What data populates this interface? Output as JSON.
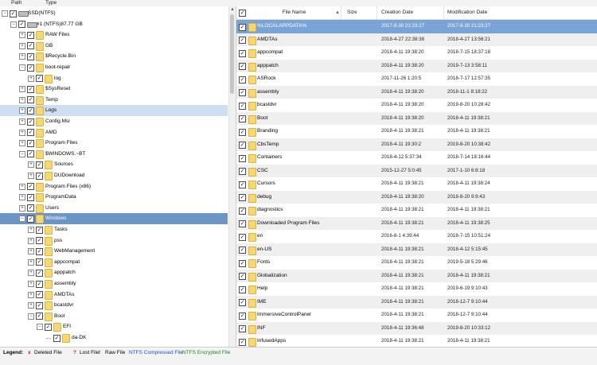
{
  "tabs": [
    "Path",
    "Type"
  ],
  "tree": [
    {
      "label": "SSD(NTFS)",
      "level": 0,
      "icon": "drive",
      "expander": "minus"
    },
    {
      "label": "#1 (NTFS)87.77 GB",
      "level": 1,
      "icon": "drive",
      "expander": "minus"
    },
    {
      "label": "RAW Files",
      "level": 2,
      "icon": "folder",
      "expander": "plus"
    },
    {
      "label": "GB",
      "level": 2,
      "icon": "folder",
      "expander": "plus"
    },
    {
      "label": "$Recycle.Bin",
      "level": 2,
      "icon": "folder",
      "expander": "plus"
    },
    {
      "label": "boot-repair",
      "level": 2,
      "icon": "folder",
      "expander": "minus"
    },
    {
      "label": "log",
      "level": 3,
      "icon": "folder",
      "expander": "plus"
    },
    {
      "label": "$SysReset",
      "level": 2,
      "icon": "folder",
      "expander": "plus"
    },
    {
      "label": "Temp",
      "level": 2,
      "icon": "folder",
      "expander": "plus"
    },
    {
      "label": "Logs",
      "level": 2,
      "icon": "folder",
      "expander": "plus",
      "selected": "light"
    },
    {
      "label": "Config.Msi",
      "level": 2,
      "icon": "folder",
      "expander": "plus"
    },
    {
      "label": "AMD",
      "level": 2,
      "icon": "folder",
      "expander": "plus"
    },
    {
      "label": "Program Files",
      "level": 2,
      "icon": "folder",
      "expander": "plus"
    },
    {
      "label": "$WINDOWS.~BT",
      "level": 2,
      "icon": "folder",
      "expander": "minus"
    },
    {
      "label": "Sources",
      "level": 3,
      "icon": "folder",
      "expander": "plus"
    },
    {
      "label": "DUDownload",
      "level": 3,
      "icon": "folder",
      "expander": "plus"
    },
    {
      "label": "Program Files (x86)",
      "level": 2,
      "icon": "folder",
      "expander": "plus"
    },
    {
      "label": "ProgramData",
      "level": 2,
      "icon": "folder",
      "expander": "plus"
    },
    {
      "label": "Users",
      "level": 2,
      "icon": "folder",
      "expander": "plus"
    },
    {
      "label": "Windows",
      "level": 2,
      "icon": "folder",
      "expander": "minus",
      "selected": "dark"
    },
    {
      "label": "Tasks",
      "level": 3,
      "icon": "folder",
      "expander": "plus"
    },
    {
      "label": "pss",
      "level": 3,
      "icon": "folder",
      "expander": "plus"
    },
    {
      "label": "WebManagement",
      "level": 3,
      "icon": "folder",
      "expander": "plus"
    },
    {
      "label": "appcompat",
      "level": 3,
      "icon": "folder",
      "expander": "plus"
    },
    {
      "label": "apppatch",
      "level": 3,
      "icon": "folder",
      "expander": "plus"
    },
    {
      "label": "assembly",
      "level": 3,
      "icon": "folder",
      "expander": "plus"
    },
    {
      "label": "AMDTAs",
      "level": 3,
      "icon": "folder",
      "expander": "plus"
    },
    {
      "label": "bcastdvr",
      "level": 3,
      "icon": "folder",
      "expander": "plus"
    },
    {
      "label": "Boot",
      "level": 3,
      "icon": "folder",
      "expander": "minus"
    },
    {
      "label": "EFI",
      "level": 4,
      "icon": "folder",
      "expander": "minus"
    },
    {
      "label": "da-DK",
      "level": 5,
      "icon": "folder",
      "expander": "none"
    }
  ],
  "columns": {
    "name": "File Name",
    "size": "Size",
    "created": "Creation Date",
    "modified": "Modification Date"
  },
  "files": [
    {
      "name": "%LOCALAPPDATA%",
      "created": "2017-9-30 21:23:27",
      "modified": "2017-9-30 21:23:27",
      "selected": true
    },
    {
      "name": "AMDTAs",
      "created": "2018-4-27 22:38:38",
      "modified": "2018-4-27 13:56:21"
    },
    {
      "name": "appcompat",
      "created": "2018-4-11 19:38:20",
      "modified": "2018-7-15 18:37:18"
    },
    {
      "name": "apppatch",
      "created": "2018-4-11 19:38:20",
      "modified": "2019-7-13 3:58:11"
    },
    {
      "name": "ASRock",
      "created": "2017-11-26 1:20:5",
      "modified": "2018-7-17 12:57:35"
    },
    {
      "name": "assembly",
      "created": "2018-4-11 19:38:20",
      "modified": "2018-11-1 8:18:22"
    },
    {
      "name": "bcastdvr",
      "created": "2018-4-11 19:38:20",
      "modified": "2019-8-20 10:28:42"
    },
    {
      "name": "Boot",
      "created": "2018-4-11 19:38:20",
      "modified": "2018-4-11 19:38:21"
    },
    {
      "name": "Branding",
      "created": "2018-4-11 19:38:21",
      "modified": "2018-4-11 19:38:21"
    },
    {
      "name": "CbsTemp",
      "created": "2018-4-11 19:30:2",
      "modified": "2019-8-20 10:38:42"
    },
    {
      "name": "Containers",
      "created": "2018-4-12 5:37:34",
      "modified": "2018-7-14 18:16:44"
    },
    {
      "name": "CSC",
      "created": "2015-12-27 5:0:45",
      "modified": "2017-1-10 6:8:18"
    },
    {
      "name": "Cursors",
      "created": "2018-4-11 19:38:21",
      "modified": "2018-4-11 19:38:24"
    },
    {
      "name": "debug",
      "created": "2018-4-11 19:38:20",
      "modified": "2018-8-20 9:9:43"
    },
    {
      "name": "diagnostics",
      "created": "2018-4-11 19:38:21",
      "modified": "2018-4-11 19:38:21"
    },
    {
      "name": "Downloaded Program Files",
      "created": "2018-4-11 19:38:21",
      "modified": "2018-4-11 19:38:25"
    },
    {
      "name": "en",
      "created": "2016-8-1 4:39:44",
      "modified": "2018-7-15 10:51:24"
    },
    {
      "name": "en-US",
      "created": "2018-4-11 19:38:21",
      "modified": "2018-4-12 5:15:45"
    },
    {
      "name": "Fonts",
      "created": "2018-4-11 19:38:21",
      "modified": "2019-5-18 5:29:46"
    },
    {
      "name": "Globalization",
      "created": "2018-4-11 19:38:21",
      "modified": "2018-4-11 19:38:21"
    },
    {
      "name": "Help",
      "created": "2018-4-11 19:38:21",
      "modified": "2019-6-19 9:10:43"
    },
    {
      "name": "IME",
      "created": "2018-4-11 19:38:21",
      "modified": "2018-12-7 9:10:44"
    },
    {
      "name": "ImmersiveControlPanel",
      "created": "2018-4-11 19:38:21",
      "modified": "2018-12-7 9:10:44"
    },
    {
      "name": "INF",
      "created": "2018-4-11 19:36:48",
      "modified": "2019-8-20 10:33:12"
    },
    {
      "name": "InfusedApps",
      "created": "2018-4-11 19:38:21",
      "modified": "2018-4-11 19:38:21"
    }
  ],
  "legend": {
    "title": "Legend:",
    "items": [
      {
        "symbol": "x",
        "label": "Deleted File",
        "color": "#d01818"
      },
      {
        "symbol": "?",
        "label": "Lost File",
        "color": "#d01818"
      },
      {
        "symbol": "!",
        "label": "Raw File",
        "color": "#d01818"
      },
      {
        "symbol": "",
        "label": "NTFS Compressed File",
        "color": "#1a4fc0"
      },
      {
        "symbol": "",
        "label": "NTFS Encrypted File",
        "color": "#1a8a1a"
      }
    ]
  },
  "colors": {
    "selected_row": "#7aa4d6",
    "tree_selected": "#6c95c5",
    "tree_highlight": "#cfdff2",
    "folder": "#f7d774"
  }
}
